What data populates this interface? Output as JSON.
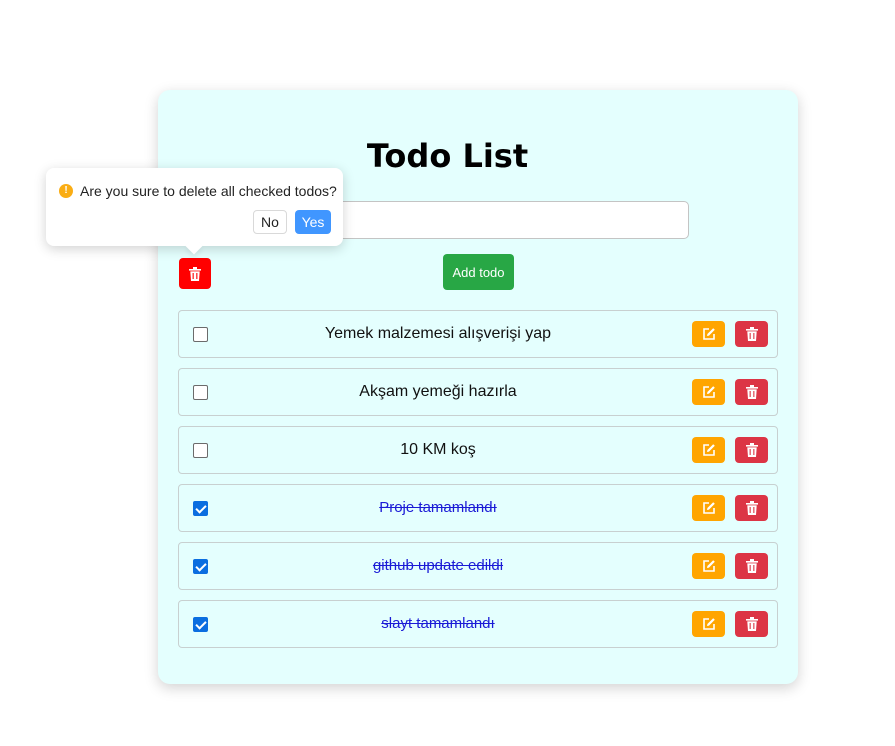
{
  "app": {
    "title": "Todo List"
  },
  "input": {
    "value": "",
    "placeholder": ""
  },
  "actions": {
    "add_label": "Add todo",
    "delete_checked_icon": "trash-icon"
  },
  "popover": {
    "message": "Are you sure to delete all checked todos?",
    "no_label": "No",
    "yes_label": "Yes",
    "icon": "exclamation-circle-icon"
  },
  "todos": [
    {
      "text": "Yemek malzemesi alışverişi yap",
      "checked": false
    },
    {
      "text": "Akşam yemeği hazırla",
      "checked": false
    },
    {
      "text": "10 KM koş",
      "checked": false
    },
    {
      "text": "Proje tamamlandı",
      "checked": true
    },
    {
      "text": "github update edildi",
      "checked": true
    },
    {
      "text": "slayt tamamlandı",
      "checked": true
    }
  ],
  "colors": {
    "card_bg": "#e4fffe",
    "add_button": "#28a745",
    "delete_checked_button": "#ff0000",
    "edit_button": "#ffa500",
    "delete_button": "#dc3545",
    "done_text": "#1b1bd6",
    "popover_yes": "#4096ff",
    "warning": "#faad14"
  }
}
